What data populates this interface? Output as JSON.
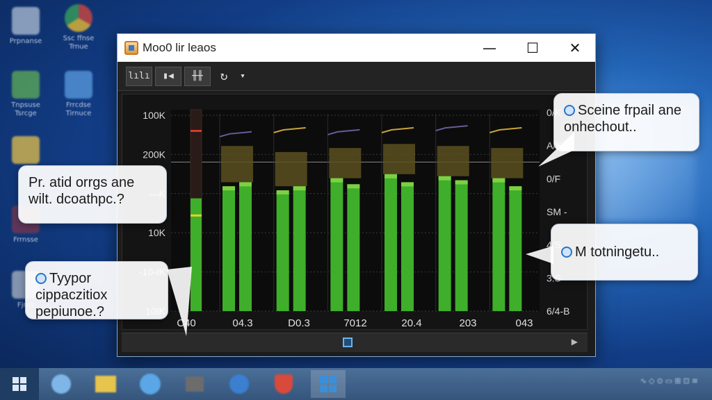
{
  "desktop": {
    "icons": [
      {
        "name": "recycle-bin",
        "label": "Prpnanse",
        "color": "#d9e4ef"
      },
      {
        "name": "chrome",
        "label": "Ssc ffnse Trnue",
        "color": "#e8b23a"
      },
      {
        "name": "control-panel",
        "label": "Tnpsuse Tsrcge",
        "color": "#5fae58"
      },
      {
        "name": "network",
        "label": "Frrcdse Tirnuce",
        "color": "#5b9ce0"
      },
      {
        "name": "folder",
        "label": "Frn",
        "color": "#e6c04a"
      },
      {
        "name": "app",
        "label": "Frrnsse",
        "color": "#c03a3a"
      },
      {
        "name": "files",
        "label": "Fjnrs",
        "color": "#aab6c4"
      }
    ]
  },
  "window": {
    "title": "Moo0 lir leaos",
    "controls": {
      "minimize": "—",
      "maximize": "☐",
      "close": "✕"
    }
  },
  "toolbar": {
    "buttons": [
      {
        "name": "bars-view",
        "label": "lılı"
      },
      {
        "name": "speaker",
        "label": "▮◀"
      },
      {
        "name": "equalizer",
        "label": "╫╫"
      },
      {
        "name": "refresh",
        "label": "↻"
      },
      {
        "name": "dropdown",
        "label": "▾"
      }
    ]
  },
  "chart_data": {
    "type": "bar",
    "left_tick_labels": [
      "100K",
      "200K",
      "—K",
      "10K",
      "-10-IK",
      "10IK"
    ],
    "right_tick_labels": [
      "0/K",
      "A/K",
      "0/F",
      "SM -",
      "4/S",
      "3.S",
      "6/4-B"
    ],
    "x_labels": [
      "C40",
      "04.3",
      "D0.3",
      "7012",
      "20.4",
      "203",
      "043"
    ],
    "meter": {
      "level": 0.56,
      "peak": 0.9,
      "marker": 0.48
    },
    "groups": [
      {
        "bars": [
          0.62,
          0.64
        ],
        "band_top": 0.82,
        "peak_line": 0.88
      },
      {
        "bars": [
          0.6,
          0.62
        ],
        "band_top": 0.79,
        "peak_line": 0.9
      },
      {
        "bars": [
          0.66,
          0.63
        ],
        "band_top": 0.81,
        "peak_line": 0.89
      },
      {
        "bars": [
          0.68,
          0.64
        ],
        "band_top": 0.83,
        "peak_line": 0.9
      },
      {
        "bars": [
          0.67,
          0.65
        ],
        "band_top": 0.82,
        "peak_line": 0.91
      },
      {
        "bars": [
          0.66,
          0.62
        ],
        "band_top": 0.81,
        "peak_line": 0.9
      }
    ],
    "colors": {
      "bar": "#3fae2a",
      "bar_top": "#8fd84a",
      "band": "#5a5020",
      "peak_line": "#6c5a9a",
      "peak_line_alt": "#c9a43a",
      "grid": "#3a3a3a"
    }
  },
  "bubbles": {
    "left_top": {
      "line1": "Pr. atid orrgs ane",
      "line2": "wilt. dcoathpc.?"
    },
    "left_bottom": {
      "line1": "Tyypor cippaczitiox",
      "line2": "pepiunoe.?"
    },
    "right_top": {
      "line1": "Sceine frpail ane",
      "line2": "onhechout.."
    },
    "right_mid": {
      "line1": "M totningetu.."
    }
  },
  "taskbar": {
    "items": [
      {
        "name": "edge",
        "color": "#7fb6e8"
      },
      {
        "name": "explorer",
        "color": "#e7c44b"
      },
      {
        "name": "chat",
        "color": "#5aa6e6"
      },
      {
        "name": "media",
        "color": "#6c6c6c"
      },
      {
        "name": "shield",
        "color": "#3b7fd1"
      },
      {
        "name": "security",
        "color": "#d84a3c"
      },
      {
        "name": "active-app",
        "color": "#3b8fd8"
      }
    ],
    "tray_text": "∿ ◇ ⊙ ▭ ⊞ ⊡ ≋"
  }
}
